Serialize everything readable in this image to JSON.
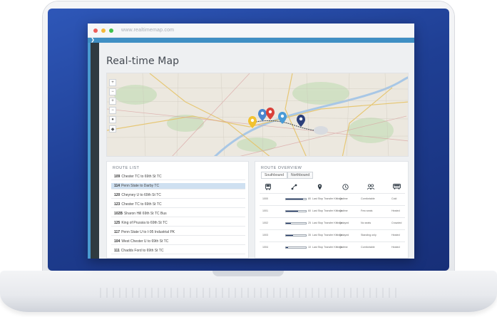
{
  "browser": {
    "url": "www.realtimemap.com",
    "traffic_lights": [
      "#ee5d5a",
      "#f5b93a",
      "#3fc24d"
    ],
    "nav_icon": "chevron-right-icon",
    "accent": "#3f8fc4"
  },
  "page": {
    "title": "Real-time Map"
  },
  "map": {
    "controls": [
      "+",
      "−",
      "+",
      "−",
      "●",
      "◆"
    ],
    "markers": [
      {
        "color": "#f2c230",
        "icon": "pin-icon"
      },
      {
        "color": "#4a86cf",
        "icon": "pin-icon"
      },
      {
        "color": "#d9413a",
        "icon": "pin-icon"
      },
      {
        "color": "#4a9bd6",
        "icon": "pin-icon"
      },
      {
        "color": "#2b3f7a",
        "icon": "pin-icon"
      }
    ]
  },
  "route_list": {
    "title": "ROUTE LIST",
    "items": [
      {
        "num": "109",
        "name": "Chester TC to 69th St TC"
      },
      {
        "num": "114",
        "name": "Penn State to Darby TC"
      },
      {
        "num": "120",
        "name": "Cheyney U to 69th St TC"
      },
      {
        "num": "123",
        "name": "Chester TC to 69th St TC"
      },
      {
        "num": "102B",
        "name": "Sharon Hill 69th St TC Bus"
      },
      {
        "num": "125",
        "name": "King of Prussia to 69th St TC"
      },
      {
        "num": "117",
        "name": "Penn State U to I-95 Industrial PK"
      },
      {
        "num": "104",
        "name": "West Chester U to 69th St TC"
      },
      {
        "num": "111",
        "name": "Chadds Ford to 69th St TC"
      }
    ],
    "selected_index": 1
  },
  "route_overview": {
    "title": "ROUTE OVERVIEW",
    "tabs": [
      "Southbound",
      "Northbound"
    ],
    "active_tab": 0,
    "column_icons": [
      "bus-icon",
      "stops-icon",
      "location-icon",
      "clock-icon",
      "riders-icon",
      "vehicle-icon"
    ],
    "rows": [
      {
        "id": "1000",
        "fill": 0.85,
        "count": "80",
        "c1": "Last Stop Transfer Kittings",
        "c2": "Ontime",
        "c3": "Comfortable",
        "c4": "Cold"
      },
      {
        "id": "1001",
        "fill": 0.6,
        "count": "60",
        "c1": "Last Stop Transfer Kittings",
        "c2": "Ontime",
        "c3": "Few seats",
        "c4": "Heated"
      },
      {
        "id": "1002",
        "fill": 0.25,
        "count": "25",
        "c1": "Last Stop Transfer Kittings",
        "c2": "Delayed",
        "c3": "No seats",
        "c4": "Crowded"
      },
      {
        "id": "1003",
        "fill": 0.35,
        "count": "35",
        "c1": "Last Stop Transfer Kittings",
        "c2": "Delayed",
        "c3": "Standing only",
        "c4": "Heated"
      },
      {
        "id": "1004",
        "fill": 0.1,
        "count": "10",
        "c1": "Last Stop Transfer Kittings",
        "c2": "Ontime",
        "c3": "Comfortable",
        "c4": "Heated"
      }
    ]
  }
}
